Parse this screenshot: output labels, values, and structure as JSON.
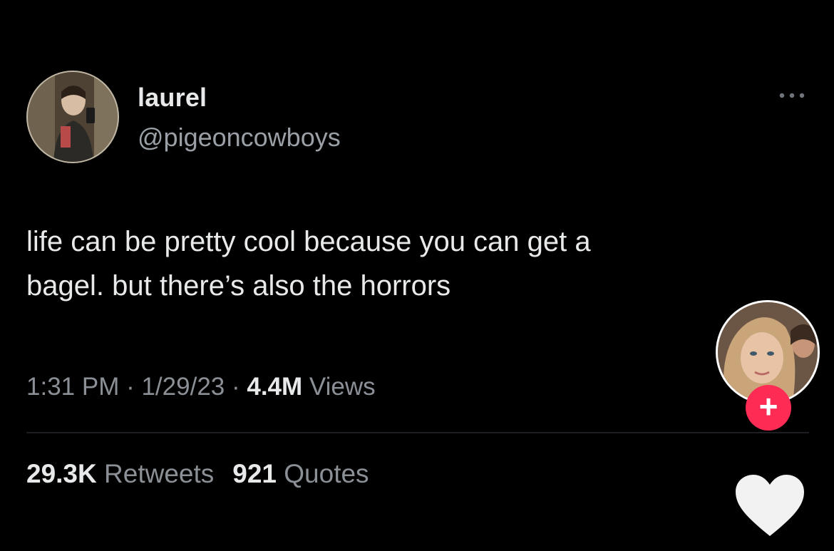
{
  "tweet": {
    "author": {
      "display_name": "laurel",
      "handle": "@pigeoncowboys",
      "avatar_icon": "profile-photo"
    },
    "more_icon": "more-horizontal-icon",
    "text_lines": [
      "life can be pretty cool because you can get a",
      "bagel. but there’s also the horrors"
    ],
    "meta": {
      "time": "1:31 PM",
      "separator": " · ",
      "date": "1/29/23",
      "views_count": "4.4M",
      "views_label": "Views"
    },
    "stats": {
      "retweets_count": "29.3K",
      "retweets_label": "Retweets",
      "quotes_count": "921",
      "quotes_label": "Quotes"
    }
  },
  "overlay": {
    "creator_avatar_icon": "creator-profile-photo",
    "follow_label": "+",
    "like_icon": "heart-icon",
    "colors": {
      "follow_button": "#fe2c55",
      "heart": "#f2f2f2",
      "background": "#000000"
    }
  }
}
